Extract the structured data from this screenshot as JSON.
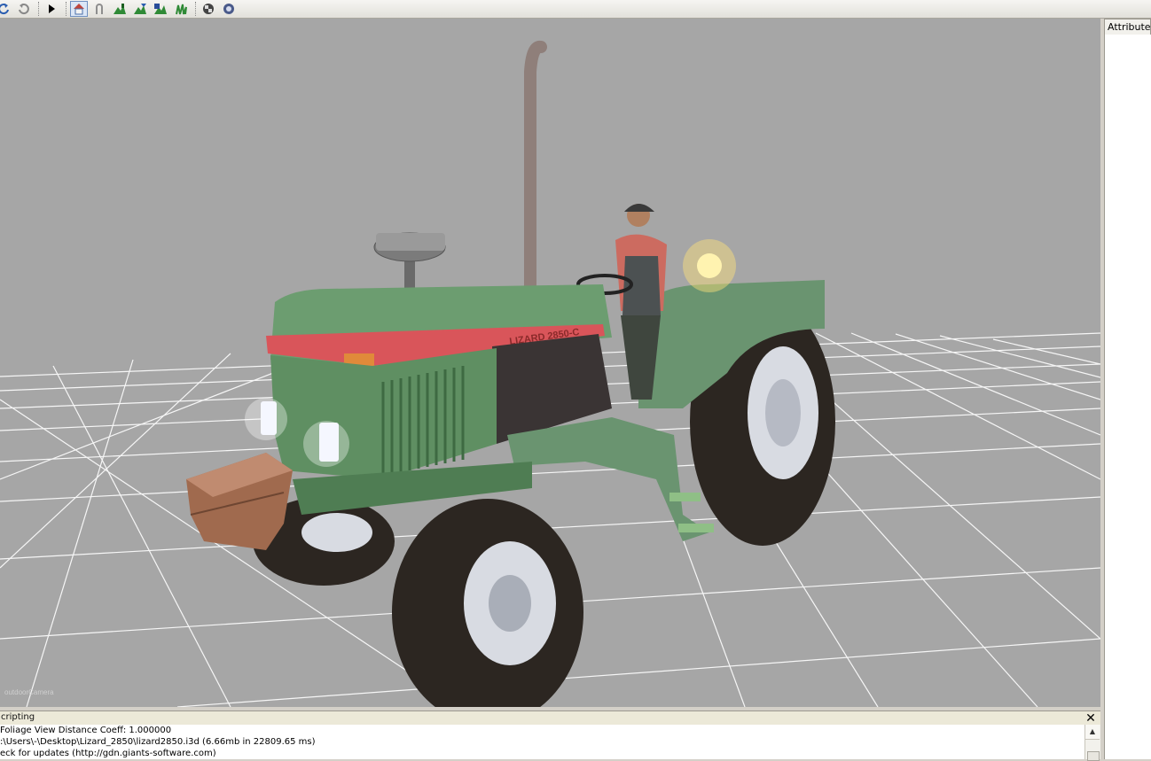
{
  "toolbar": {
    "buttons": [
      "redo-icon",
      "undo-icon",
      "play-icon",
      "home-icon",
      "magnet-icon",
      "terrain-tool-icon",
      "terrain-paint-icon",
      "terrain-save-icon",
      "foliage-tool-icon",
      "checker-icon",
      "camera-tool-icon"
    ]
  },
  "viewport": {
    "camera_label": "outdoorCamera",
    "model_decal": "LIZARD 2850-C"
  },
  "side_panel": {
    "tab_label": "Attributes"
  },
  "console": {
    "title": "cripting",
    "close_label": "✕",
    "lines": [
      "Foliage View Distance Coeff: 1.000000",
      ":\\Users\\-\\Desktop\\Lizard_2850\\lizard2850.i3d (6.66mb in 22809.65 ms)",
      "eck for updates (http://gdn.giants-software.com)"
    ],
    "scroll_up_label": "▲"
  },
  "colors": {
    "viewport_bg": "#a6a6a6",
    "grid": "#ffffff",
    "tractor_green": "#5f8f62",
    "stripe_red": "#d9555a"
  }
}
